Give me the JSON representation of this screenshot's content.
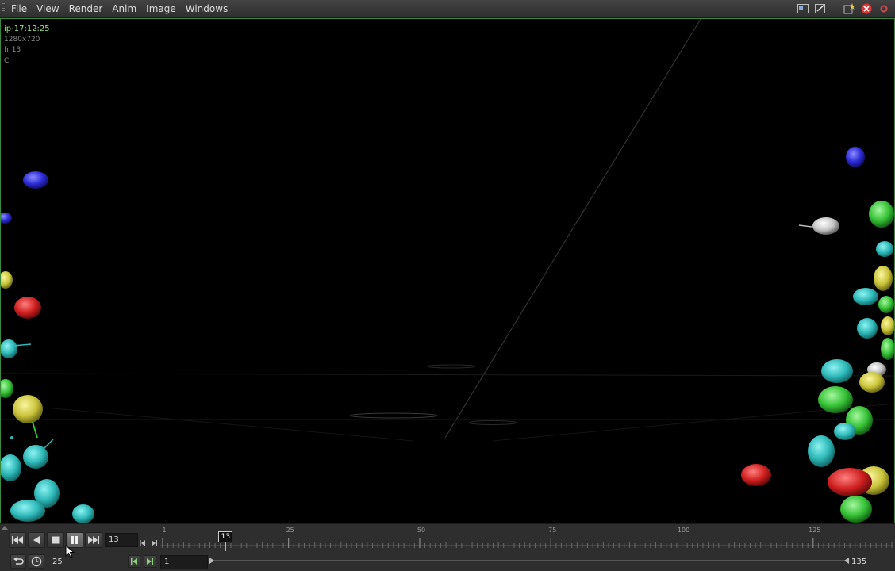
{
  "menubar": {
    "items": [
      "File",
      "View",
      "Render",
      "Anim",
      "Image",
      "Windows"
    ],
    "icons": [
      "layout-toggle-icon",
      "panel-edit-icon",
      "new-desktop-icon",
      "close-red-icon",
      "dot-red-icon"
    ]
  },
  "viewport": {
    "hud": {
      "name": "ip-17:12:25",
      "resolution": "1280x720",
      "frame": "fr 13",
      "plane": "C"
    },
    "colors": {
      "cyan": "#35c8c8",
      "green": "#3fcf3f",
      "yellow": "#c8c23a",
      "red": "#d42424",
      "blue": "#2a2ad8",
      "white": "#cfcfcf"
    }
  },
  "playbar": {
    "current_frame": "13",
    "fps": "25",
    "range_start": "1",
    "range_end": "135",
    "timeline": {
      "start": 1,
      "end": 135,
      "current": 13,
      "labels": [
        "1",
        "25",
        "50",
        "75",
        "100",
        "125"
      ]
    },
    "buttons": [
      "jump-start",
      "play-reverse",
      "stop",
      "pause",
      "jump-end"
    ]
  }
}
